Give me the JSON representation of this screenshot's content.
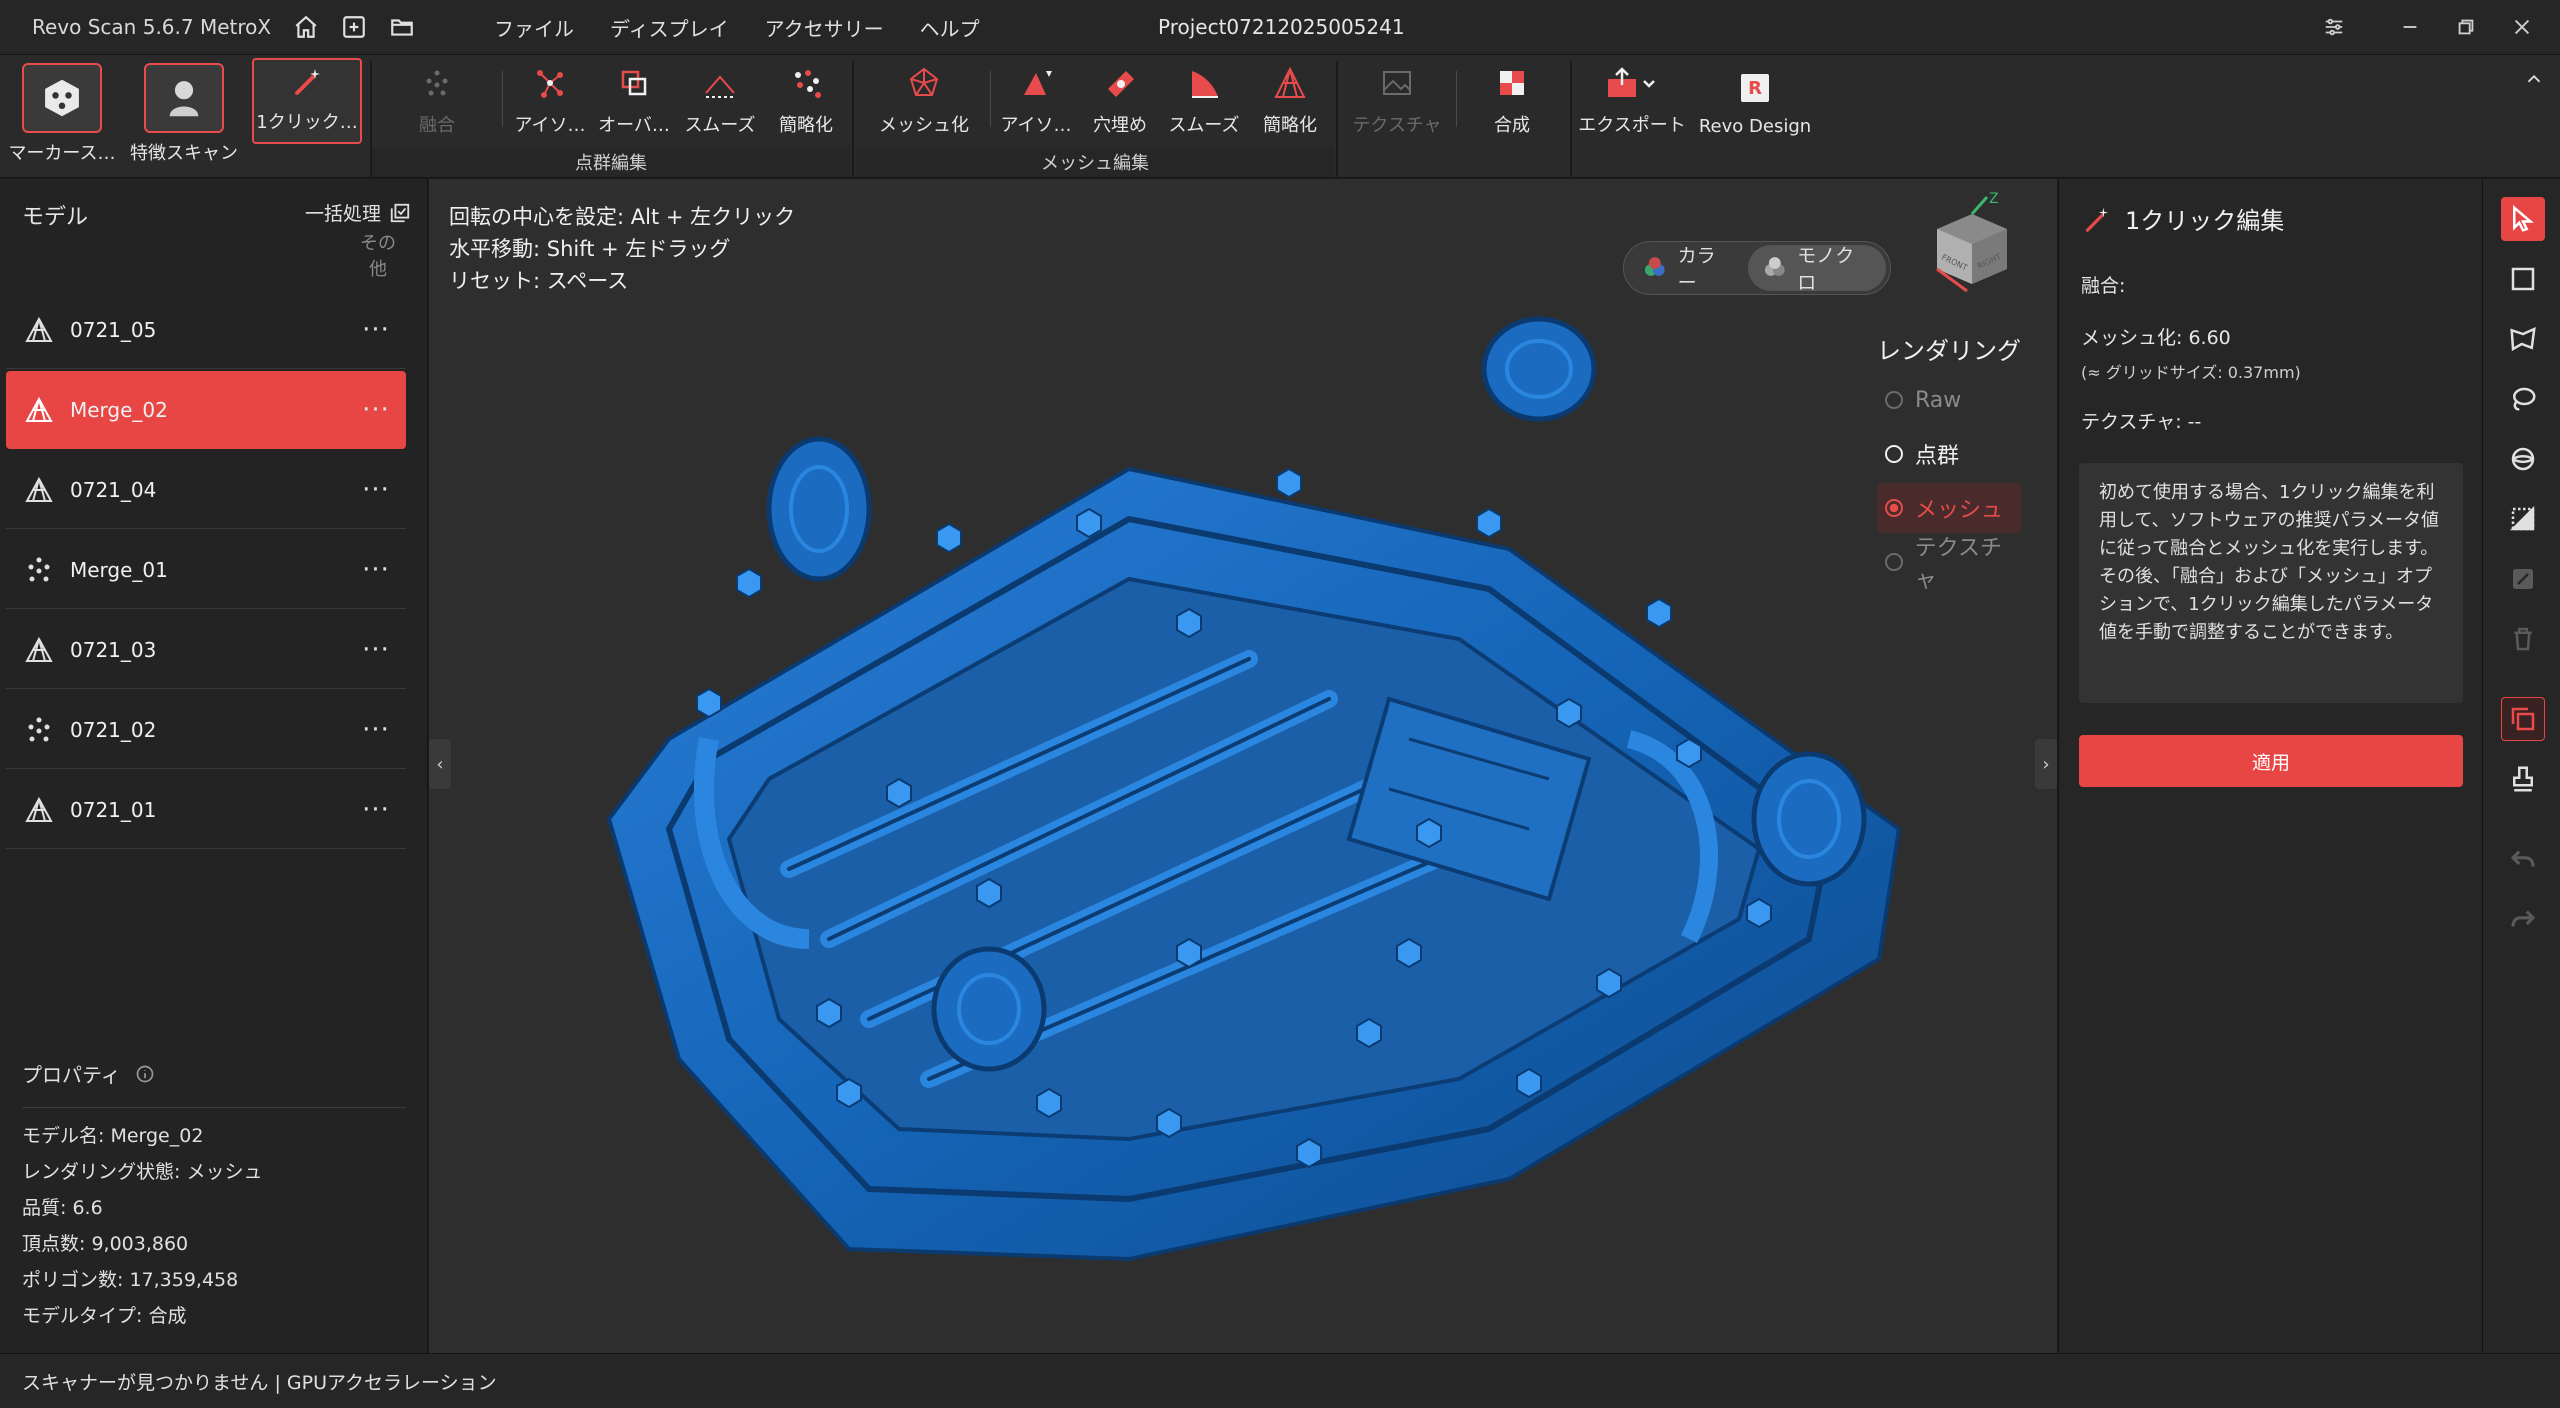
{
  "app": {
    "title": "Revo Scan 5.6.7 MetroX",
    "project": "Project07212025005241",
    "menu": [
      "ファイル",
      "ディスプレイ",
      "アクセサリー",
      "ヘルプ"
    ]
  },
  "toolbar": {
    "marker_scan": "マーカース…",
    "feature_scan": "特徴スキャン",
    "one_click": "1クリック…",
    "fusion": "融合",
    "isolation1": "アイソ…",
    "overlap": "オーバ…",
    "smooth1": "スムーズ",
    "simplify1": "簡略化",
    "pointcloud_group": "点群編集",
    "meshing": "メッシュ化",
    "isolation2": "アイソ…",
    "hole_fill": "穴埋め",
    "smooth2": "スムーズ",
    "simplify2": "簡略化",
    "mesh_group": "メッシュ編集",
    "texture": "テクスチャ",
    "merge": "合成",
    "export": "エクスポート",
    "revo_design": "Revo Design"
  },
  "left": {
    "header": "モデル",
    "batch": "一括処理",
    "other_line1": "その",
    "other_line2": "他",
    "models": [
      {
        "name": "0721_05",
        "type": "mesh"
      },
      {
        "name": "Merge_02",
        "type": "mesh",
        "selected": true
      },
      {
        "name": "0721_04",
        "type": "mesh"
      },
      {
        "name": "Merge_01",
        "type": "points"
      },
      {
        "name": "0721_03",
        "type": "mesh"
      },
      {
        "name": "0721_02",
        "type": "points"
      },
      {
        "name": "0721_01",
        "type": "mesh"
      }
    ],
    "more": "···",
    "properties": {
      "title": "プロパティ",
      "model_name": "モデル名:  Merge_02",
      "render_state": "レンダリング状態:  メッシュ",
      "quality": "品質:  6.6",
      "vertices": "頂点数:  9,003,860",
      "polygons": "ポリゴン数:  17,359,458",
      "model_type": "モデルタイプ:  合成"
    }
  },
  "viewport": {
    "hint1": "回転の中心を設定: Alt + 左クリック",
    "hint2": "水平移動: Shift + 左ドラッグ",
    "hint3": "リセット: スペース",
    "color_label": "カラー",
    "mono_label": "モノクロ",
    "rendering_title": "レンダリング",
    "render_options": [
      "Raw",
      "点群",
      "メッシュ",
      "テクスチャ"
    ],
    "render_selected": "メッシュ",
    "gizmo_axis": "Z",
    "gizmo_front": "FRONT",
    "gizmo_right": "RIGHT",
    "mesh_color": "#1565b8"
  },
  "right": {
    "title": "1クリック編集",
    "fusion": "融合:",
    "meshing": "メッシュ化:  6.60",
    "grid": "(≈ グリッドサイズ: 0.37mm)",
    "texture": "テクスチャ: --",
    "description": "初めて使用する場合、1クリック編集を利用して、ソフトウェアの推奨パラメータ値に従って融合とメッシュ化を実行します。その後、「融合」および「メッシュ」オプションで、1クリック編集したパラメータ値を手動で調整することができます。",
    "apply": "適用"
  },
  "status": {
    "text": "スキャナーが見つかりません  | GPUアクセラレーション"
  },
  "colors": {
    "accent": "#e84545",
    "panel": "#262626",
    "viewport": "#2e2e2e"
  }
}
